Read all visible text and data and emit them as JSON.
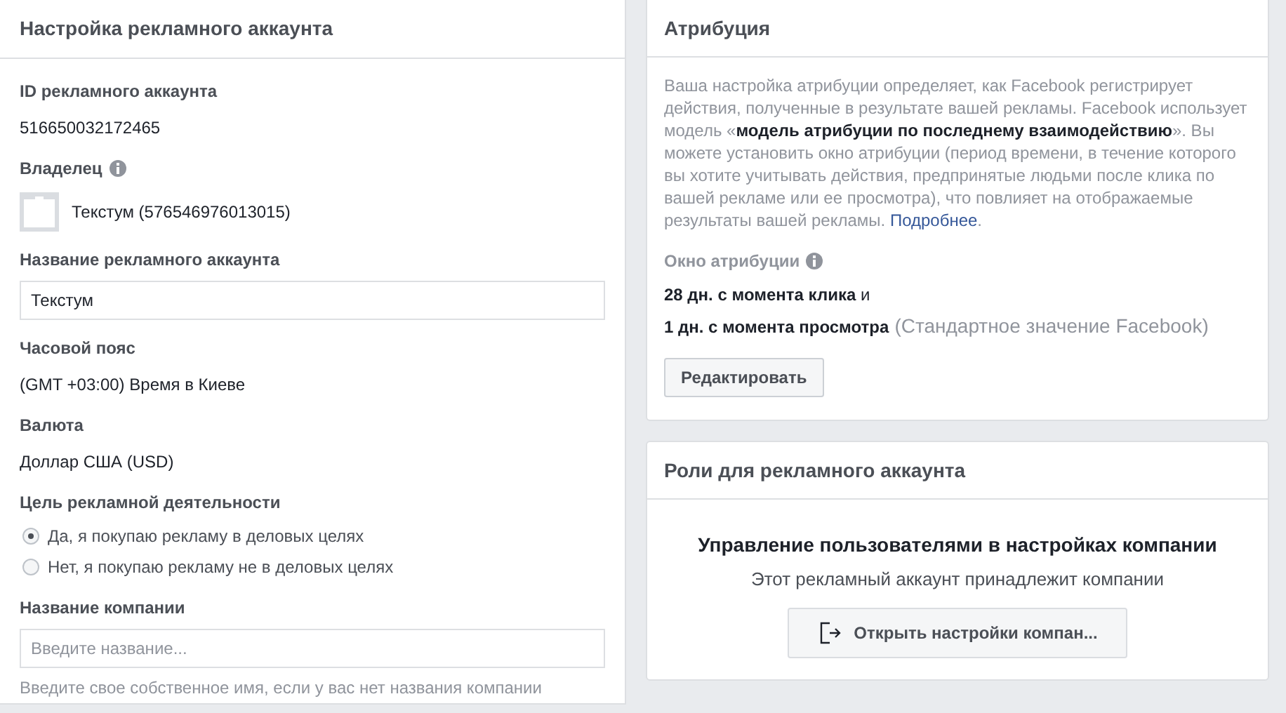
{
  "account_settings": {
    "title": "Настройка рекламного аккаунта",
    "fields": [
      {
        "kind": "text",
        "label": "ID рекламного аккаунта",
        "value": "516650032172465"
      },
      {
        "kind": "owner",
        "label": "Владелец",
        "value": "Текстум (576546976013015)"
      },
      {
        "kind": "input",
        "label": "Название рекламного аккаунта",
        "value": "Текстум"
      },
      {
        "kind": "text",
        "label": "Часовой пояс",
        "value": "(GMT +03:00) Время в Киеве"
      },
      {
        "kind": "text",
        "label": "Валюта",
        "value": "Доллар США (USD)"
      },
      {
        "kind": "radio",
        "label": "Цель рекламной деятельности",
        "options": [
          {
            "label": "Да, я покупаю рекламу в деловых целях",
            "selected": true
          },
          {
            "label": "Нет, я покупаю рекламу не в деловых целях",
            "selected": false
          }
        ]
      },
      {
        "kind": "input",
        "label": "Название компании",
        "placeholder": "Введите название...",
        "hint": "Введите свое собственное имя, если у вас нет названия компании"
      }
    ]
  },
  "attribution": {
    "title": "Атрибуция",
    "description": "Ваша настройка атрибуции определяет, как Facebook регистрирует действия, полученные в результате вашей рекламы. Facebook использует модель «**модель атрибуции по последнему взаимодействию**». Вы можете установить окно атрибуции (период времени, в течение которого вы хотите учитывать действия, предпринятые людьми после клика по вашей рекламе или ее просмотра), что повлияет на отображаемые результаты вашей рекламы.",
    "link": "Подробнее",
    "link_after": ".",
    "window_label": "Окно атрибуции",
    "windows": [
      {
        "text": "**28 дн. с момента клика** и"
      },
      {
        "text": "**1 дн. с момента просмотра**",
        "note": "(Стандартное значение Facebook)"
      }
    ],
    "button": "Редактировать"
  },
  "roles": {
    "title": "Роли для рекламного аккаунта",
    "heading": "Управление пользователями в настройках компании",
    "subtitle": "Этот рекламный аккаунт принадлежит компании",
    "button": "Открыть настройки компан..."
  }
}
